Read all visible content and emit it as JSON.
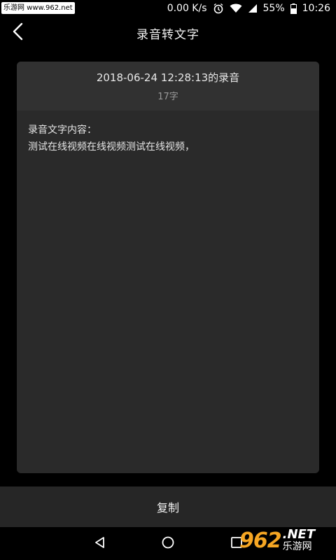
{
  "status_bar": {
    "watermark": "乐游网 www.962.net",
    "speed": "0.00 K/s",
    "battery": "55%",
    "time": "10:26"
  },
  "header": {
    "title": "录音转文字"
  },
  "recording": {
    "title": "2018-06-24 12:28:13的录音",
    "char_count": "17字",
    "content_label": "录音文字内容：",
    "content_text": "测试在线视频在线视频测试在线视频，"
  },
  "footer": {
    "copy_label": "复制"
  },
  "watermark_logo": {
    "number": "962",
    "net": ".NET",
    "cn": "乐游网"
  },
  "colors": {
    "background": "#000000",
    "card": "#2a2a2a",
    "card_header": "#313131",
    "bar": "#262626",
    "logo_accent": "#f5a623"
  }
}
